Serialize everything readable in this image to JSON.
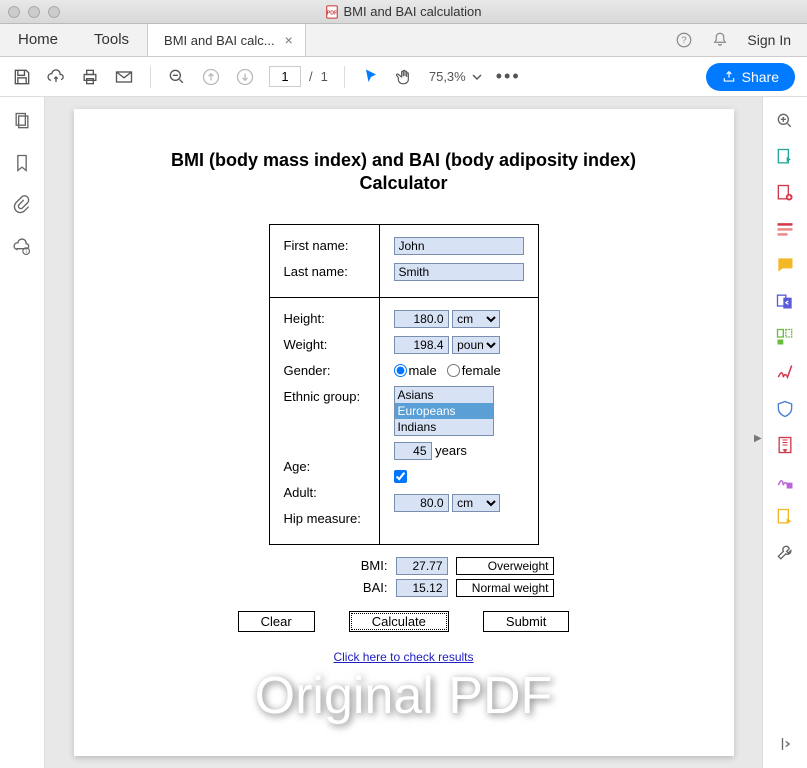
{
  "window": {
    "title": "BMI and BAI calculation"
  },
  "tabs": {
    "home": "Home",
    "tools": "Tools",
    "document": "BMI and BAI calc...",
    "signin": "Sign In"
  },
  "toolbar": {
    "current_page": "1",
    "page_sep": "/",
    "total_pages": "1",
    "zoom": "75,3%",
    "share": "Share"
  },
  "document": {
    "title_line1": "BMI (body mass index) and BAI (body adiposity index)",
    "title_line2": "Calculator",
    "labels": {
      "first_name": "First name:",
      "last_name": "Last name:",
      "height": "Height:",
      "weight": "Weight:",
      "gender": "Gender:",
      "ethnic_group": "Ethnic group:",
      "age": "Age:",
      "adult": "Adult:",
      "hip": "Hip measure:",
      "bmi": "BMI:",
      "bai": "BAI:",
      "years": "years",
      "male": "male",
      "female": "female"
    },
    "values": {
      "first_name": "John",
      "last_name": "Smith",
      "height": "180.0",
      "height_unit": "cm",
      "weight": "198.4",
      "weight_unit": "pound",
      "gender": "male",
      "ethnic_options": [
        "Asians",
        "Europeans",
        "Indians"
      ],
      "ethnic_selected": "Europeans",
      "age": "45",
      "adult": true,
      "hip": "80.0",
      "hip_unit": "cm",
      "bmi": "27.77",
      "bmi_category": "Overweight",
      "bai": "15.12",
      "bai_category": "Normal weight"
    },
    "buttons": {
      "clear": "Clear",
      "calculate": "Calculate",
      "submit": "Submit"
    },
    "link": "Click here to check results",
    "watermark": "Original PDF"
  }
}
